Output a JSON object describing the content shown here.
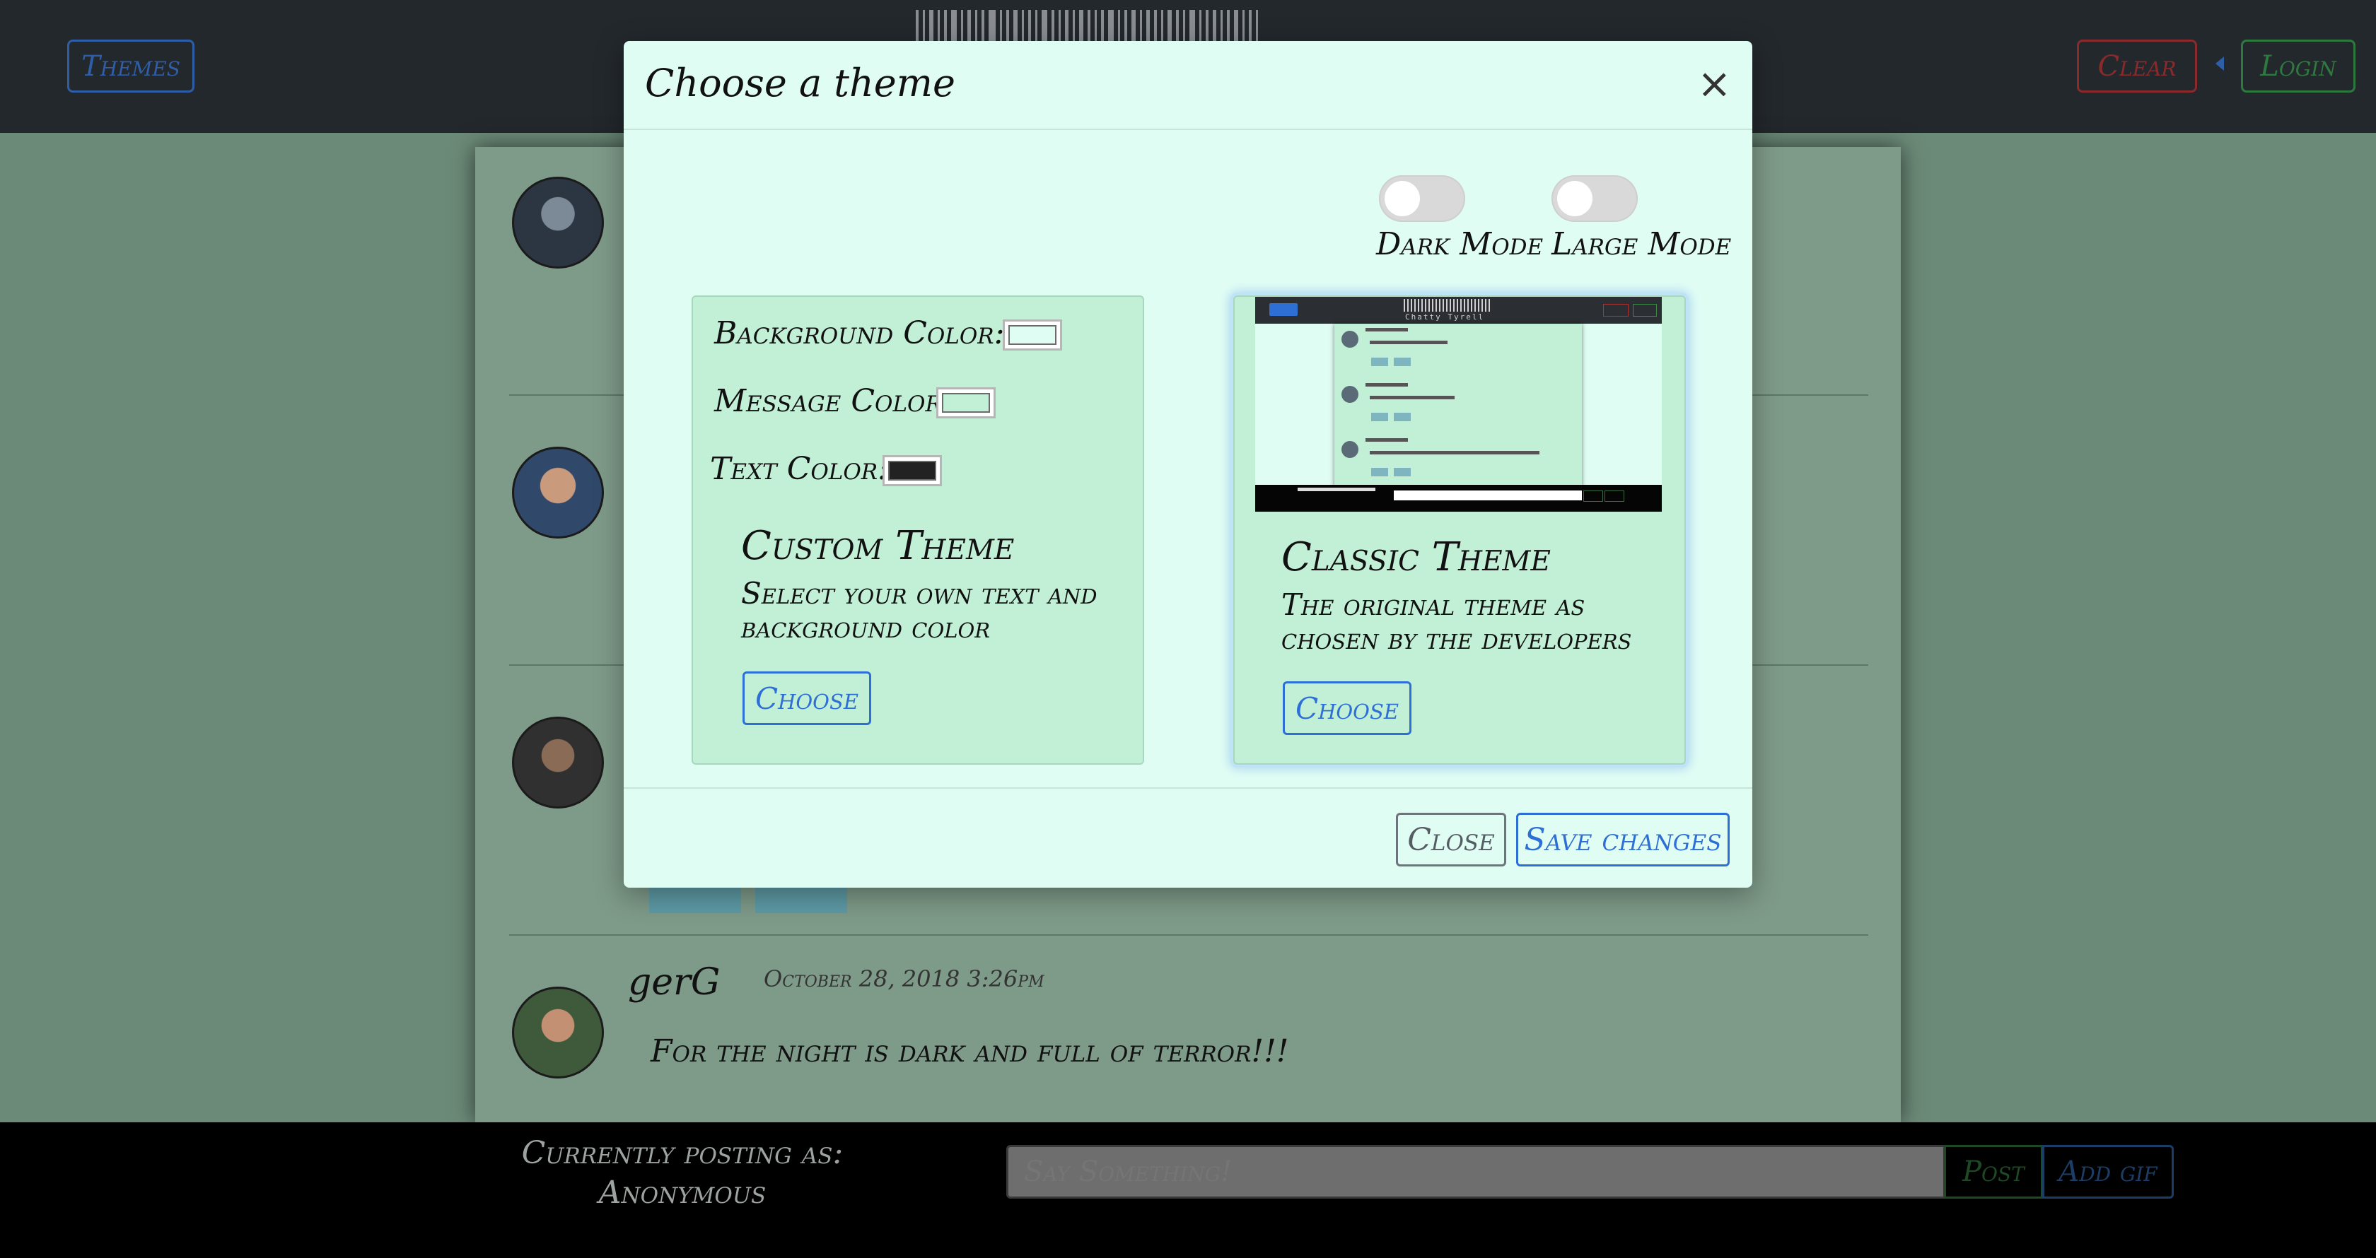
{
  "header": {
    "themes_label": "Themes",
    "clear_label": "Clear",
    "login_label": "Login"
  },
  "feed": {
    "last_message": {
      "author": "gerG",
      "date": "October 28, 2018 3:26pm",
      "text": "For the night is dark and full of terror!!!"
    }
  },
  "footer": {
    "posting_as_label": "Currently posting as:",
    "posting_as_user": "Anonymous",
    "input_placeholder": "Say Something!",
    "post_label": "Post",
    "add_gif_label": "Add gif"
  },
  "modal": {
    "title": "Choose a theme",
    "close_symbol": "×",
    "toggles": [
      {
        "label": "Dark Mode",
        "on": false
      },
      {
        "label": "Large Mode",
        "on": false
      }
    ],
    "custom_card": {
      "fields": [
        {
          "label": "Background Color:",
          "color": "#e0fdf4"
        },
        {
          "label": "Message Color:",
          "color": "#c2f0d6"
        },
        {
          "label": "Text Color:",
          "color": "#222222"
        }
      ],
      "title": "Custom Theme",
      "description": "Select your own text and background color",
      "choose_label": "Choose"
    },
    "classic_card": {
      "title": "Classic Theme",
      "description": "The original theme as chosen by the developers",
      "choose_label": "Choose",
      "preview_brand": "Chatty Tyrell",
      "selected": true
    },
    "close_label": "Close",
    "save_label": "Save changes"
  },
  "icons": {
    "close": "close-icon",
    "dropdown": "caret-left-icon",
    "barcode": "barcode-logo"
  },
  "colors": {
    "accent_blue": "#2e6fd6",
    "danger_red": "#8a2a2a",
    "success_green": "#2e7a3e",
    "modal_bg": "#e0fdf4",
    "card_bg": "#c2f0d6"
  }
}
